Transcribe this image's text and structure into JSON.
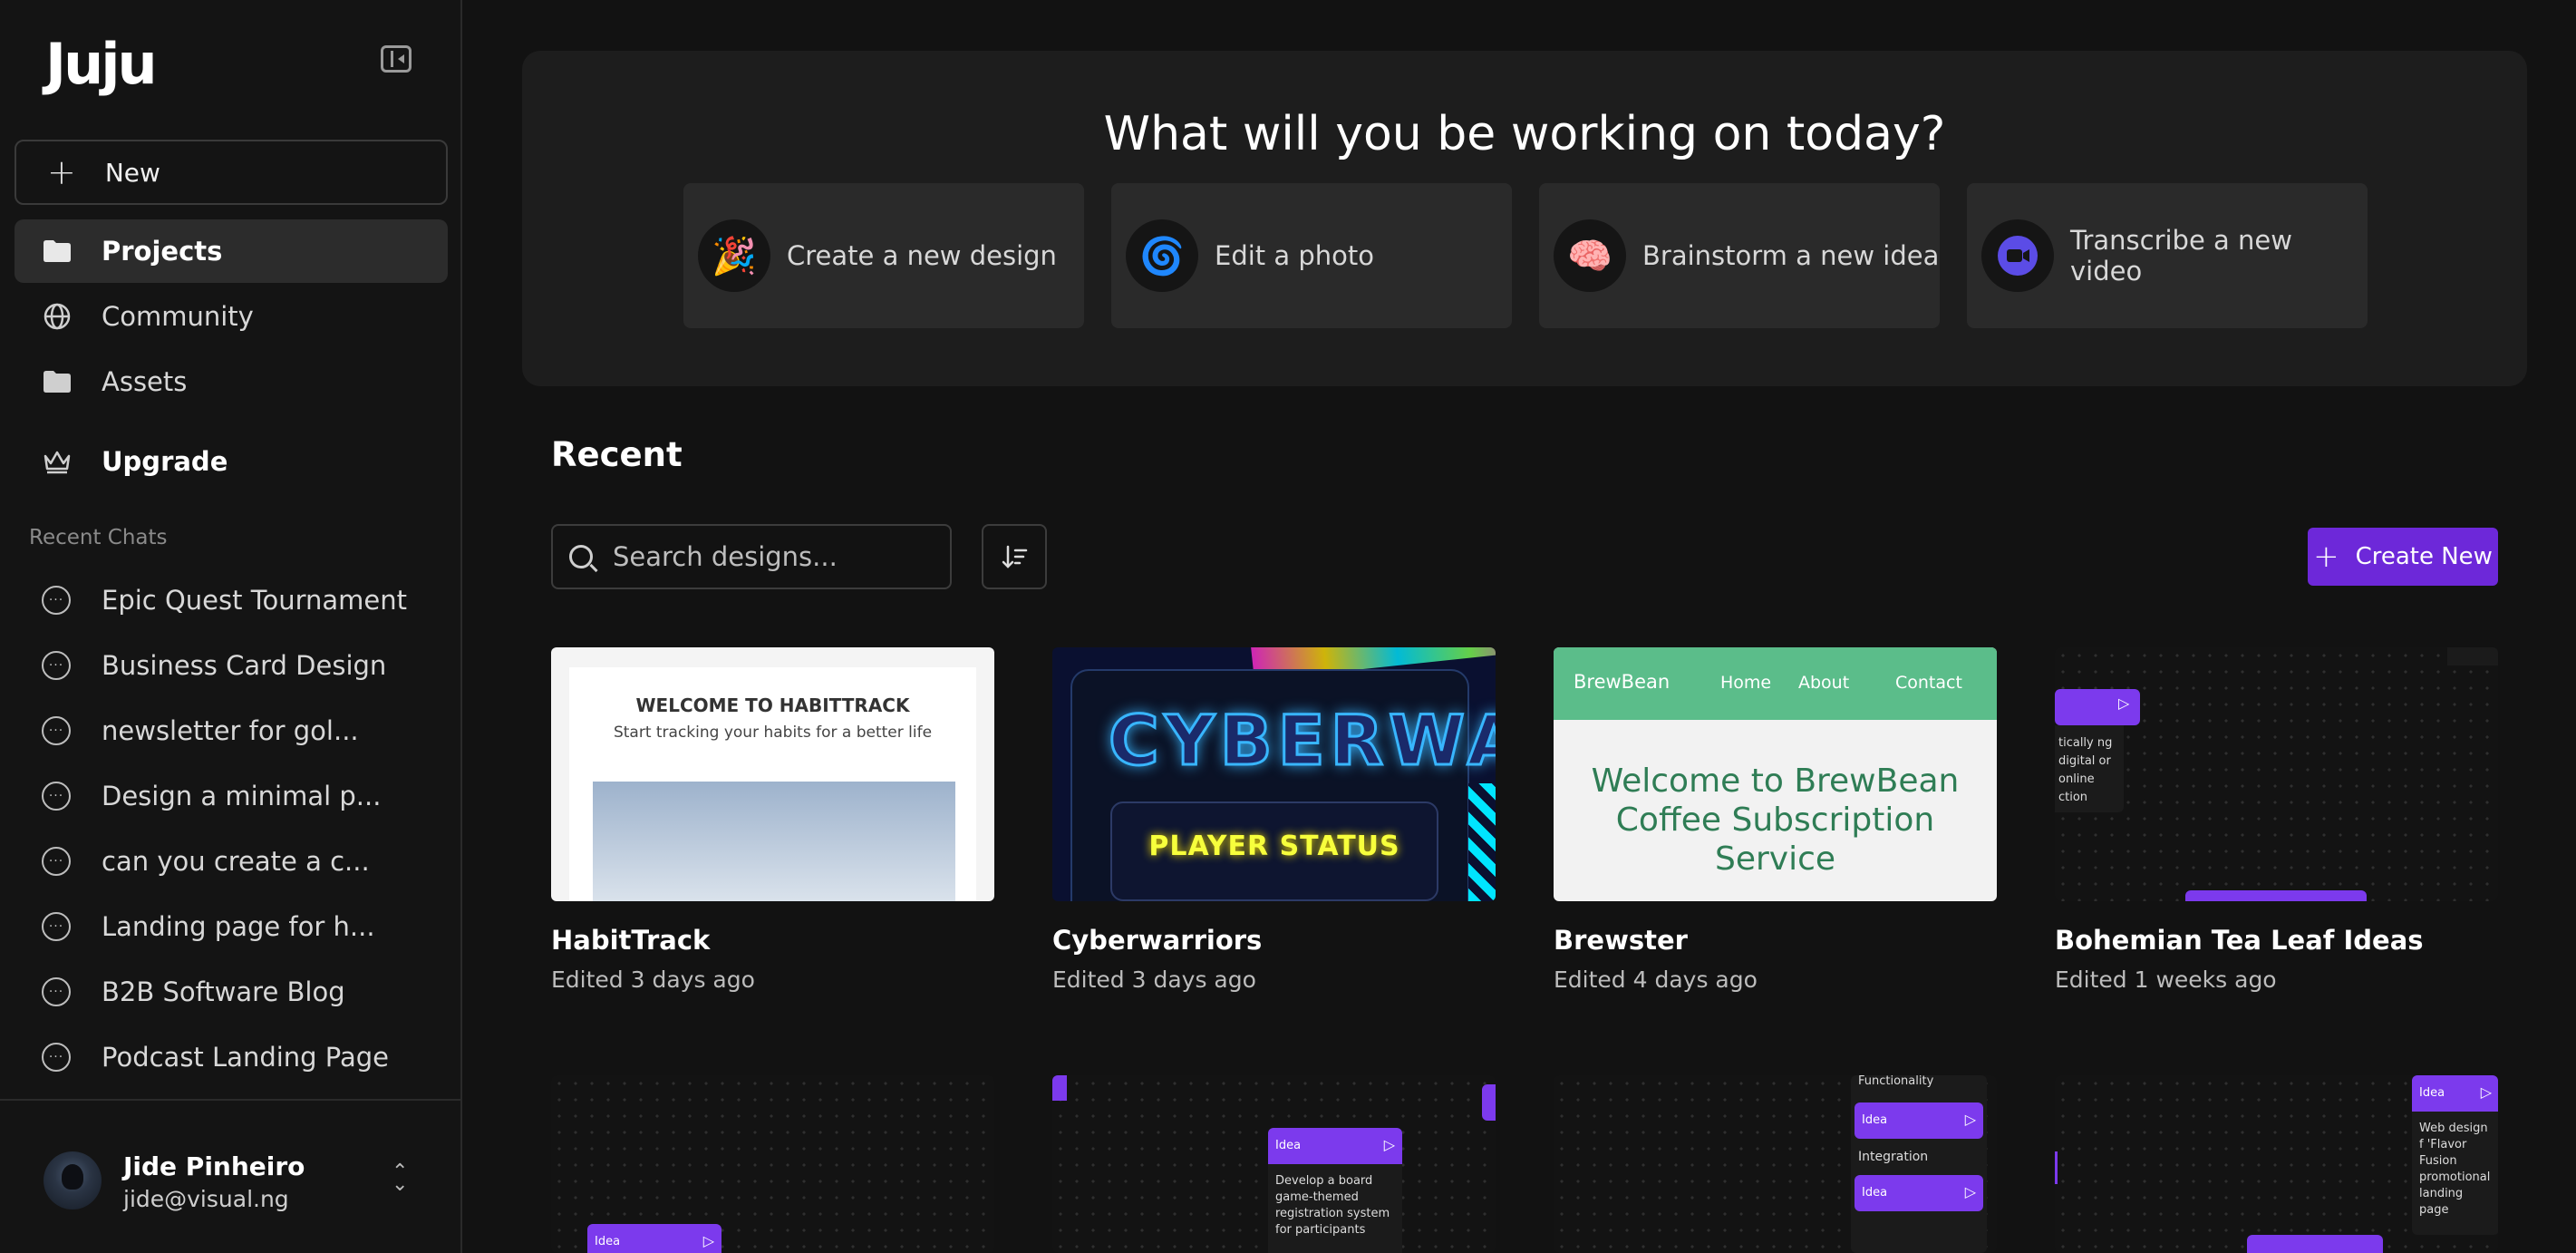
{
  "app": {
    "logo": "Juju"
  },
  "sidebar": {
    "new_label": "New",
    "nav": [
      {
        "label": "Projects"
      },
      {
        "label": "Community"
      },
      {
        "label": "Assets"
      },
      {
        "label": "Upgrade"
      }
    ],
    "recent_chats_label": "Recent Chats",
    "chats": [
      "Epic Quest Tournament",
      "Business Card Design",
      "newsletter for gol...",
      "Design a minimal p...",
      "can you create a c...",
      "Landing page for h...",
      "B2B Software Blog",
      "Podcast Landing Page"
    ],
    "user": {
      "name": "Jide Pinheiro",
      "email": "jide@visual.ng"
    }
  },
  "hero": {
    "title": "What will you be working on today?",
    "actions": [
      {
        "label": "Create a new design",
        "icon": "party-popper-icon"
      },
      {
        "label": "Edit a photo",
        "icon": "spiral-icon"
      },
      {
        "label": "Brainstorm a new idea",
        "icon": "brain-icon"
      },
      {
        "label": "Transcribe a new video",
        "icon": "video-camera-icon"
      }
    ]
  },
  "recent": {
    "title": "Recent",
    "search_placeholder": "Search designs...",
    "create_label": "Create New",
    "cards": [
      {
        "title": "HabitTrack",
        "edited": "Edited 3 days ago"
      },
      {
        "title": "Cyberwarriors",
        "edited": "Edited 3 days ago"
      },
      {
        "title": "Brewster",
        "edited": "Edited 4 days ago"
      },
      {
        "title": "Bohemian Tea Leaf Ideas",
        "edited": "Edited 1 weeks ago"
      }
    ]
  },
  "thumbnails": {
    "habittrack": {
      "heading": "WELCOME TO HABITTRACK",
      "sub": "Start tracking your habits for a better life"
    },
    "cyber": {
      "logo": "CYBERWA",
      "status": "PLAYER STATUS"
    },
    "brew": {
      "brand": "BrewBean",
      "nav": [
        "Home",
        "About",
        "Contact"
      ],
      "hero": "Welcome to BrewBean Coffee Subscription Service"
    },
    "bohemian": {
      "snippet": "tically ng digital or online ction"
    },
    "board2": {
      "node_label": "Idea",
      "node_text": "Develop a board game-themed registration system for participants"
    },
    "board3": {
      "items": [
        "Functionality",
        "Idea",
        "Integration",
        "Idea"
      ]
    },
    "board4": {
      "node_label": "Idea",
      "node_text": "Web design f 'Flavor Fusion promotional landing page"
    },
    "board1": {
      "node_label": "Idea"
    }
  },
  "colors": {
    "accent": "#6d28d9",
    "brew_green": "#5bbd8a"
  }
}
